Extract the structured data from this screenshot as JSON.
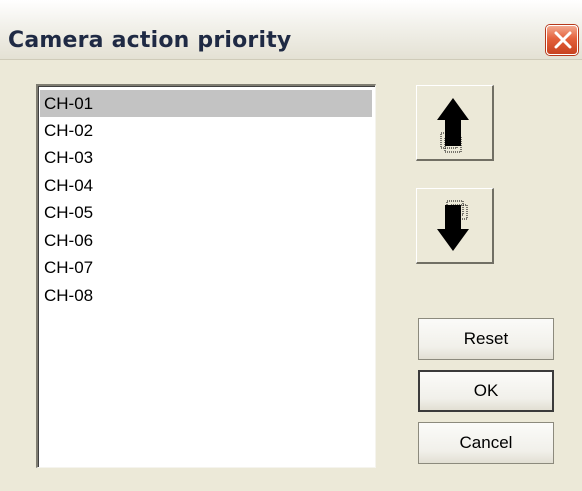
{
  "window": {
    "title": "Camera action priority"
  },
  "channels": {
    "items": [
      "CH-01",
      "CH-02",
      "CH-03",
      "CH-04",
      "CH-05",
      "CH-06",
      "CH-07",
      "CH-08"
    ],
    "selected": "CH-01"
  },
  "buttons": {
    "move_up_icon": "arrow-up-icon",
    "move_down_icon": "arrow-down-icon",
    "reset_label": "Reset",
    "ok_label": "OK",
    "cancel_label": "Cancel"
  },
  "colors": {
    "selection_bg": "#c3c3c3",
    "close_button": "#e4613c"
  }
}
